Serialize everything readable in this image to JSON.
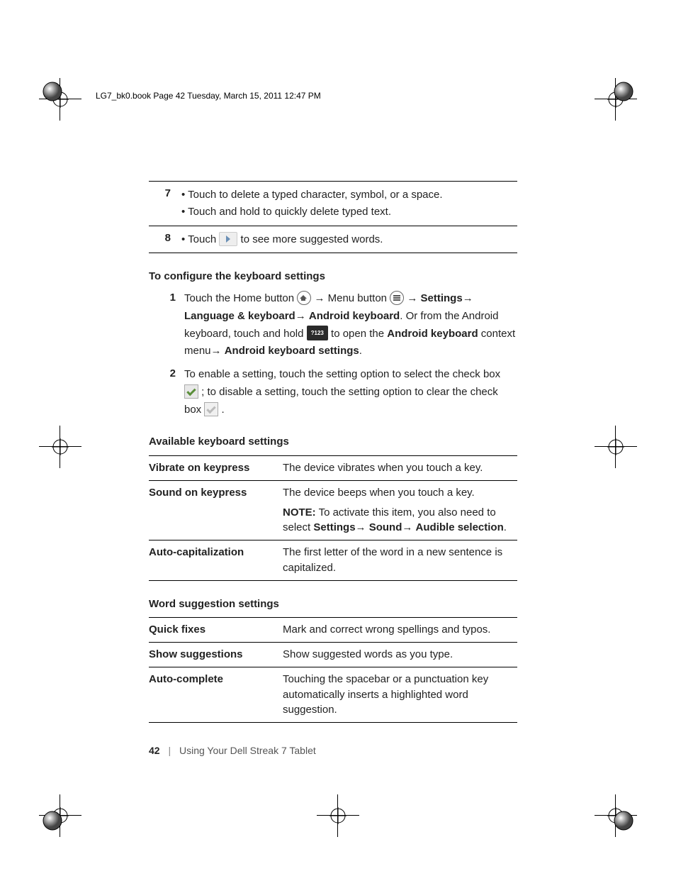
{
  "header": "LG7_bk0.book  Page 42  Tuesday, March 15, 2011  12:47 PM",
  "row7": {
    "num": "7",
    "b1": "Touch to delete a typed character, symbol, or a space.",
    "b2": "Touch and hold to quickly delete typed text."
  },
  "row8": {
    "num": "8",
    "pre": "Touch ",
    "post": " to see more suggested words."
  },
  "sec_configure": "To configure the keyboard settings",
  "step1": {
    "n": "1",
    "t1": "Touch the Home button ",
    "t2": " Menu button ",
    "t3": " ",
    "s_settings": "Settings",
    "t4": " ",
    "s_lk": "Language & keyboard",
    "s_ak": "Android keyboard",
    "t5": ". Or from the Android keyboard, touch and hold ",
    "t6": " to open the ",
    "s_akb": "Android keyboard",
    "t7": " context menu",
    "s_aks": "Android keyboard settings",
    "dot": "."
  },
  "step2": {
    "n": "2",
    "t1": "To enable a setting, touch the setting option to select the check box ",
    "t2": " ; to disable a setting, touch the setting option to clear the check box ",
    "t3": " ."
  },
  "sec_avail": "Available keyboard settings",
  "avail": {
    "r1a": "Vibrate on keypress",
    "r1b": "The device vibrates when you touch a key.",
    "r2a": "Sound on keypress",
    "r2b": "The device beeps when you touch a key.",
    "note_l": "NOTE:",
    "note_t1": " To activate this item, you also need to select ",
    "note_b1": "Settings",
    "note_b2": "Sound",
    "note_b3": "Audible selection",
    "note_dot": ".",
    "r3a": "Auto-capitalization",
    "r3b": "The first letter of the word in a new sentence is capitalized."
  },
  "sec_word": "Word suggestion settings",
  "word": {
    "r1a": "Quick fixes",
    "r1b": "Mark and correct wrong spellings and typos.",
    "r2a": "Show suggestions",
    "r2b": "Show suggested words as you type.",
    "r3a": "Auto-complete",
    "r3b": "Touching the spacebar or a punctuation key automatically inserts a highlighted word suggestion."
  },
  "footer": {
    "page": "42",
    "chapter": "Using Your Dell Streak 7 Tablet"
  },
  "glyph": {
    "arrow": "→",
    "key123": "?123"
  }
}
